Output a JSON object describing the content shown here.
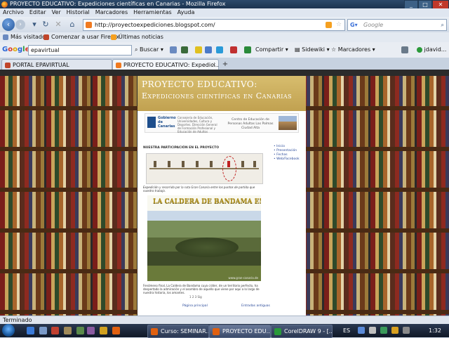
{
  "window": {
    "title": "PROYECTO EDUCATIVO: Expediciones científicas en Canarias - Mozilla Firefox",
    "buttons": [
      "_",
      "□",
      "✕"
    ]
  },
  "menu": [
    "Archivo",
    "Editar",
    "Ver",
    "Historial",
    "Marcadores",
    "Herramientas",
    "Ayuda"
  ],
  "address": {
    "url": "http://proyectoexpediciones.blogspot.com/",
    "search_placeholder": "Google"
  },
  "bookmarks": [
    "Más visitados",
    "Comenzar a usar Firefox",
    "Últimas noticias"
  ],
  "google_toolbar": {
    "input_value": "epavirtual",
    "buscar": "Buscar",
    "compartir": "Compartir",
    "sidewiki": "Sidewiki",
    "marcadores": "Marcadores",
    "user": "jdavid..."
  },
  "tabs": [
    {
      "label": "PORTAL EPAVIRTUAL"
    },
    {
      "label": "PROYECTO EDUCATIVO: Expedici..."
    }
  ],
  "blog": {
    "title_line1": "PROYECTO EDUCATIVO:",
    "title_line2": "Expediciones científicas en Canarias",
    "gob_name": "Gobierno de Canarias",
    "dir_text": "Consejería de Educación, Universidades, Cultura y Deportes. Dirección General de Formación Profesional y Educación de Adultos",
    "centro_text": "Centro de Educación de Personas Adultas Las Palmas Ciudad Alta",
    "post_heading": "NUESTRA PARTICIPACIÓN EN EL PROYECTO",
    "caption": "Expedición y recorrido por la ruta Gran Canaria entre los puntos de partida que nuestro trabajo.",
    "photo_title": "LA CALDERA DE BANDAMA EN GRAN CANARIA",
    "photo_credit": "www.gran-canaria.de",
    "body": "Fenómeno final, La Caldera de Bandama cuya cráter, de un territorio perfecto, ha despertado la admiración y el asombro de aquello que viene por aquí a lo largo de nuestra historia, los amantes.",
    "pager": "1 2 3 Sig",
    "links": [
      "Página principal",
      "Entradas antiguas"
    ],
    "sidebar_links": [
      "Inicio",
      "Presentación",
      "Fechas",
      "Web/Facebook"
    ]
  },
  "status": "Terminado",
  "taskbar": {
    "tasks": [
      "Curso: SEMINAR...",
      "PROYECTO EDU...",
      "CorelDRAW 9 - [..."
    ],
    "lang": "ES",
    "clock": "1:32"
  }
}
